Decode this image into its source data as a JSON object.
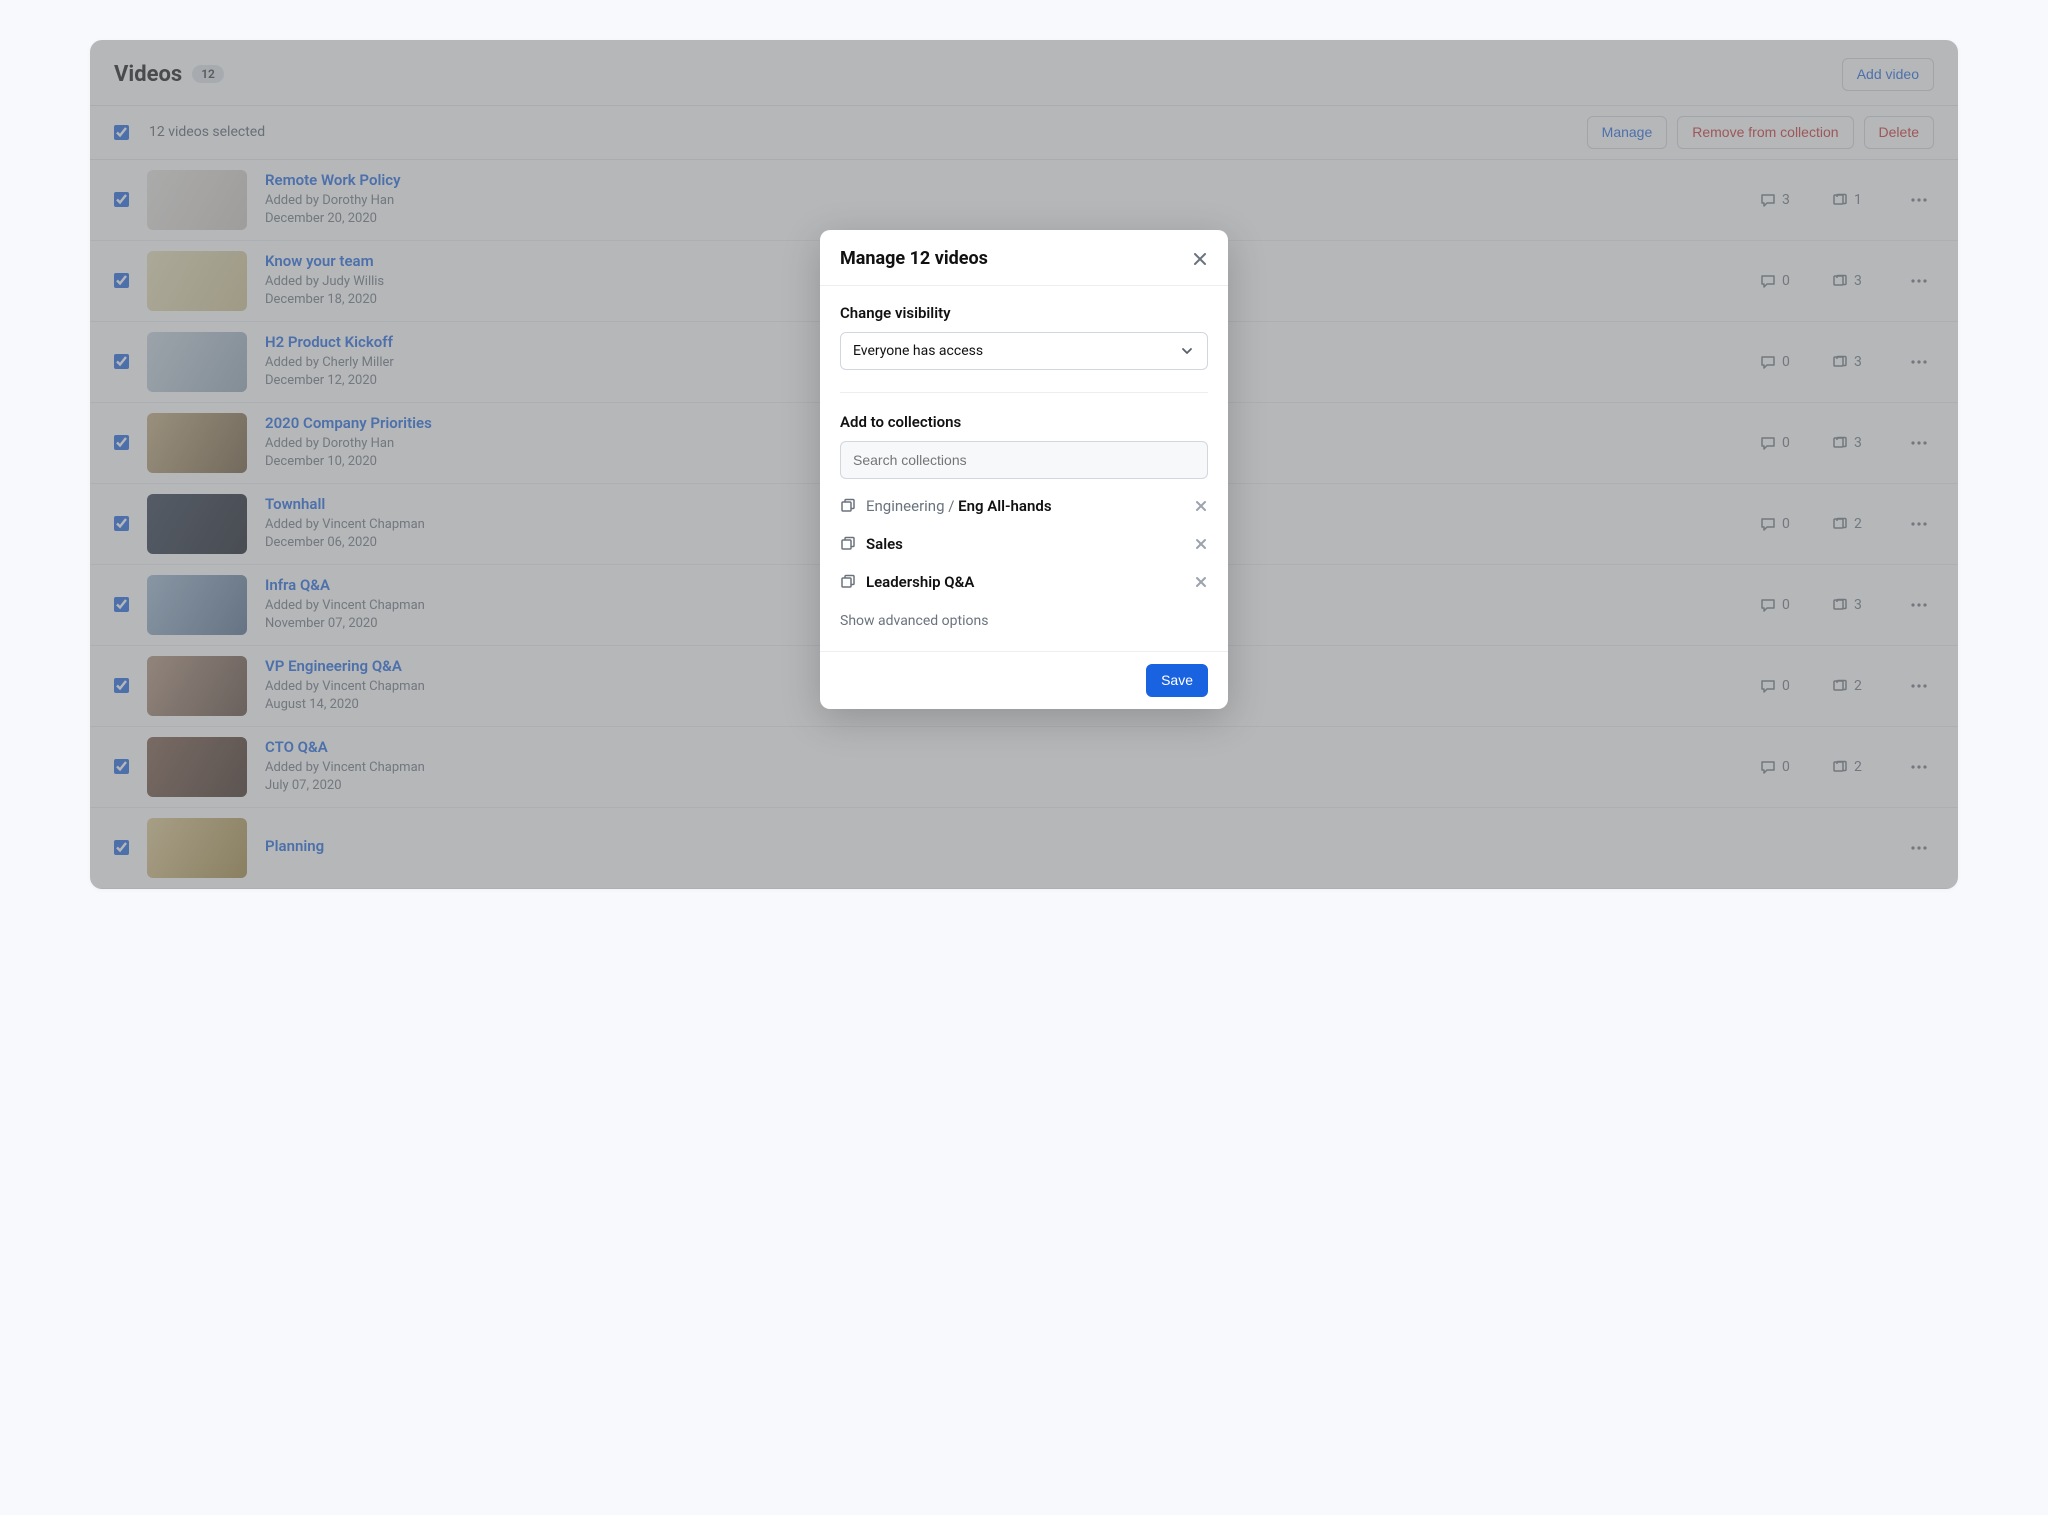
{
  "header": {
    "title": "Videos",
    "count": "12",
    "add_button": "Add video"
  },
  "selection_bar": {
    "summary": "12 videos selected",
    "manage": "Manage",
    "remove": "Remove from collection",
    "delete": "Delete"
  },
  "added_by_prefix": "Added by ",
  "videos": [
    {
      "title": "Remote Work Policy",
      "author": "Dorothy Han",
      "date": "December 20, 2020",
      "comments": "3",
      "collections": "1"
    },
    {
      "title": "Know your team",
      "author": "Judy Willis",
      "date": "December 18, 2020",
      "comments": "0",
      "collections": "3"
    },
    {
      "title": "H2 Product Kickoff",
      "author": "Cherly Miller",
      "date": "December 12, 2020",
      "comments": "0",
      "collections": "3"
    },
    {
      "title": "2020 Company Priorities",
      "author": "Dorothy Han",
      "date": "December 10, 2020",
      "comments": "0",
      "collections": "3"
    },
    {
      "title": "Townhall",
      "author": "Vincent Chapman",
      "date": "December 06, 2020",
      "comments": "0",
      "collections": "2"
    },
    {
      "title": "Infra Q&A",
      "author": "Vincent Chapman",
      "date": "November 07, 2020",
      "comments": "0",
      "collections": "3"
    },
    {
      "title": "VP Engineering Q&A",
      "author": "Vincent Chapman",
      "date": "August 14, 2020",
      "comments": "0",
      "collections": "2"
    },
    {
      "title": "CTO Q&A",
      "author": "Vincent Chapman",
      "date": "July 07, 2020",
      "comments": "0",
      "collections": "2"
    },
    {
      "title": "Planning",
      "author": "",
      "date": "",
      "comments": "",
      "collections": ""
    }
  ],
  "modal": {
    "title": "Manage 12 videos",
    "visibility_label": "Change visibility",
    "visibility_value": "Everyone has access",
    "add_label": "Add to collections",
    "search_placeholder": "Search collections",
    "collections": [
      {
        "parent": "Engineering",
        "name": "Eng All-hands"
      },
      {
        "parent": "",
        "name": "Sales"
      },
      {
        "parent": "",
        "name": "Leadership Q&A"
      }
    ],
    "advanced": "Show advanced options",
    "save": "Save"
  }
}
